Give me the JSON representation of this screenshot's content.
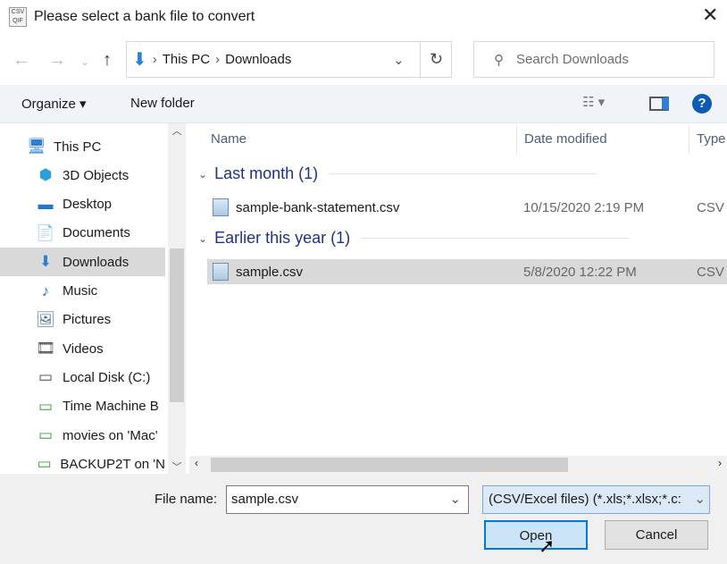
{
  "window": {
    "title": "Please select a bank file to convert",
    "app_icon_text": "CSV QIF"
  },
  "address": {
    "segments": [
      "This PC",
      "Downloads"
    ],
    "search_placeholder": "Search Downloads"
  },
  "toolbar": {
    "organize": "Organize ▾",
    "new_folder": "New folder",
    "help": "?"
  },
  "nav_pane": {
    "items": [
      {
        "label": "This PC",
        "icon": "computer-icon",
        "glyph": "🖥"
      },
      {
        "label": "3D Objects",
        "icon": "cube-icon",
        "glyph": "⬢"
      },
      {
        "label": "Desktop",
        "icon": "desktop-icon",
        "glyph": "▬"
      },
      {
        "label": "Documents",
        "icon": "document-icon",
        "glyph": "📄"
      },
      {
        "label": "Downloads",
        "icon": "download-icon",
        "glyph": "⬇",
        "selected": true
      },
      {
        "label": "Music",
        "icon": "music-icon",
        "glyph": "♪"
      },
      {
        "label": "Pictures",
        "icon": "pictures-icon",
        "glyph": "🖼"
      },
      {
        "label": "Videos",
        "icon": "videos-icon",
        "glyph": "🎞"
      },
      {
        "label": "Local Disk (C:)",
        "icon": "disk-icon",
        "glyph": "▭"
      },
      {
        "label": "Time Machine B",
        "icon": "network-drive-icon",
        "glyph": "▭"
      },
      {
        "label": "movies on 'Mac'",
        "icon": "network-drive-icon",
        "glyph": "▭"
      },
      {
        "label": "BACKUP2T on 'N",
        "icon": "network-drive-icon",
        "glyph": "▭"
      }
    ]
  },
  "columns": [
    "Name",
    "Date modified",
    "Type"
  ],
  "groups": [
    {
      "label": "Last month (1)",
      "files": [
        {
          "name": "sample-bank-statement.csv",
          "date": "10/15/2020 2:19 PM",
          "type": "CSV"
        }
      ]
    },
    {
      "label": "Earlier this year (1)",
      "files": [
        {
          "name": "sample.csv",
          "date": "5/8/2020 12:22 PM",
          "type": "CSV",
          "selected": true
        }
      ]
    }
  ],
  "footer": {
    "file_name_label": "File name:",
    "file_name_value": "sample.csv",
    "filter": "(CSV/Excel files) (*.xls;*.xlsx;*.c:",
    "open": "Open",
    "cancel": "Cancel"
  },
  "colors": {
    "accent": "#0078d7",
    "selection": "#d9d9d9",
    "group_text": "#1e3287"
  }
}
